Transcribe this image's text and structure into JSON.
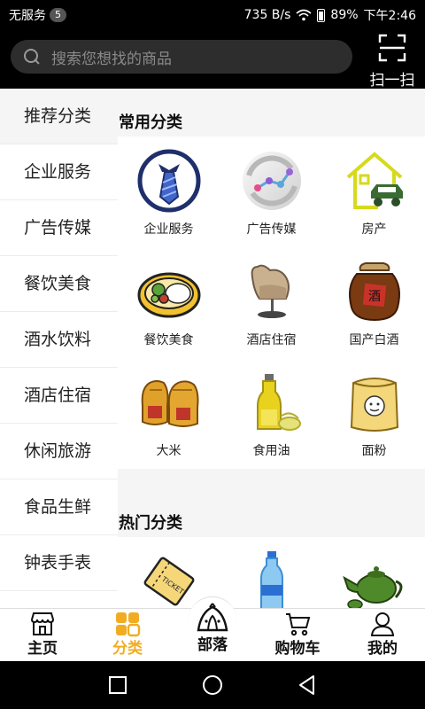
{
  "status": {
    "carrier": "无服务",
    "badge": "5",
    "speed": "735 B/s",
    "battery": "89%",
    "time": "下午2:46"
  },
  "header": {
    "search_placeholder": "搜索您想找的商品",
    "scan_label": "扫一扫"
  },
  "sidebar": {
    "items": [
      {
        "label": "推荐分类"
      },
      {
        "label": "企业服务"
      },
      {
        "label": "广告传媒"
      },
      {
        "label": "餐饮美食"
      },
      {
        "label": "酒水饮料"
      },
      {
        "label": "酒店住宿"
      },
      {
        "label": "休闲旅游"
      },
      {
        "label": "食品生鲜"
      },
      {
        "label": "钟表手表"
      }
    ],
    "active_index": 0
  },
  "common": {
    "title": "常用分类",
    "items": [
      {
        "label": "企业服务",
        "icon": "tie-icon"
      },
      {
        "label": "广告传媒",
        "icon": "media-icon"
      },
      {
        "label": "房产",
        "icon": "house-car-icon"
      },
      {
        "label": "餐饮美食",
        "icon": "food-plate-icon"
      },
      {
        "label": "酒店住宿",
        "icon": "armchair-icon"
      },
      {
        "label": "国产白酒",
        "icon": "liquor-jar-icon"
      },
      {
        "label": "大米",
        "icon": "rice-sack-icon"
      },
      {
        "label": "食用油",
        "icon": "oil-bottle-icon"
      },
      {
        "label": "面粉",
        "icon": "flour-bag-icon"
      }
    ]
  },
  "hot": {
    "title": "热门分类",
    "items": [
      {
        "icon": "ticket-icon"
      },
      {
        "icon": "water-bottle-icon"
      },
      {
        "icon": "teapot-icon"
      }
    ]
  },
  "tabs": {
    "items": [
      {
        "label": "主页",
        "icon": "store-icon"
      },
      {
        "label": "分类",
        "icon": "category-grid-icon"
      },
      {
        "label": "部落",
        "icon": "tent-icon"
      },
      {
        "label": "购物车",
        "icon": "cart-icon"
      },
      {
        "label": "我的",
        "icon": "person-icon"
      }
    ],
    "active_index": 1,
    "active_color": "#f0ad23"
  },
  "colors": {
    "header_bg": "#000000",
    "search_bg": "#2d2d2d",
    "content_bg": "#f5f5f5"
  }
}
